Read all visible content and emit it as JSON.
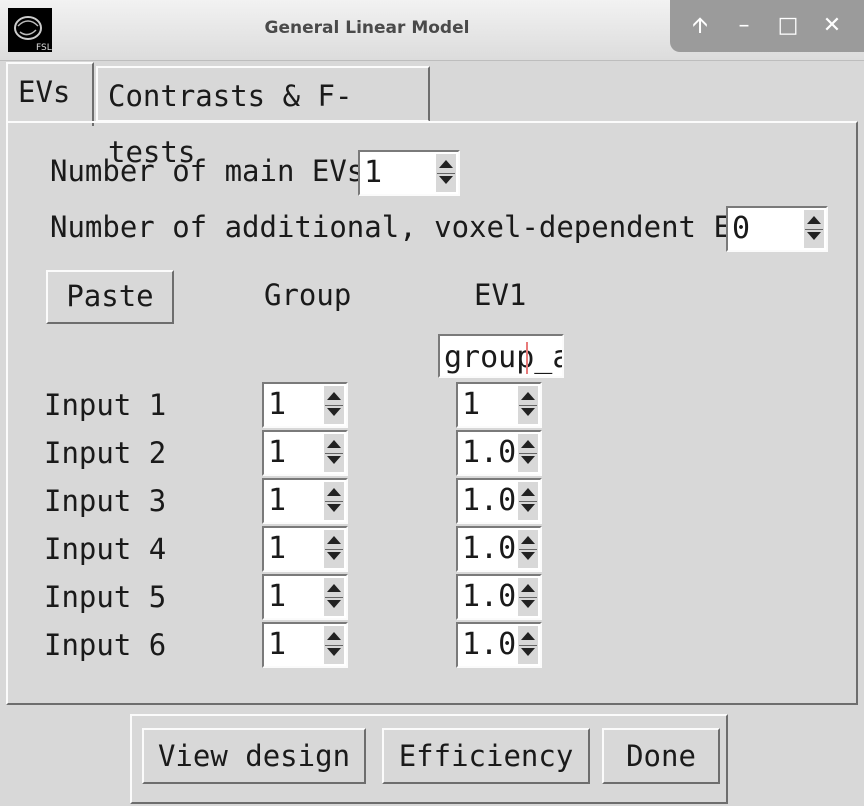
{
  "window": {
    "title": "General Linear Model",
    "controls": [
      "up-icon",
      "minimize-icon",
      "maximize-icon",
      "close-icon"
    ]
  },
  "tabs": [
    {
      "label": "EVs",
      "selected": true
    },
    {
      "label": "Contrasts & F-tests",
      "selected": false
    }
  ],
  "evs": {
    "main_label": "Number of main EVs",
    "main_value": "1",
    "additional_label": "Number of additional, voxel-dependent EVs",
    "additional_value": "0",
    "paste_label": "Paste",
    "col_group": "Group",
    "col_ev1": "EV1",
    "ev1_name": "group_av",
    "rows": [
      {
        "label": "Input 1",
        "group": "1",
        "ev1": "1"
      },
      {
        "label": "Input 2",
        "group": "1",
        "ev1": "1.0"
      },
      {
        "label": "Input 3",
        "group": "1",
        "ev1": "1.0"
      },
      {
        "label": "Input 4",
        "group": "1",
        "ev1": "1.0"
      },
      {
        "label": "Input 5",
        "group": "1",
        "ev1": "1.0"
      },
      {
        "label": "Input 6",
        "group": "1",
        "ev1": "1.0"
      }
    ]
  },
  "buttons": {
    "view_design": "View design",
    "efficiency": "Efficiency",
    "done": "Done"
  }
}
